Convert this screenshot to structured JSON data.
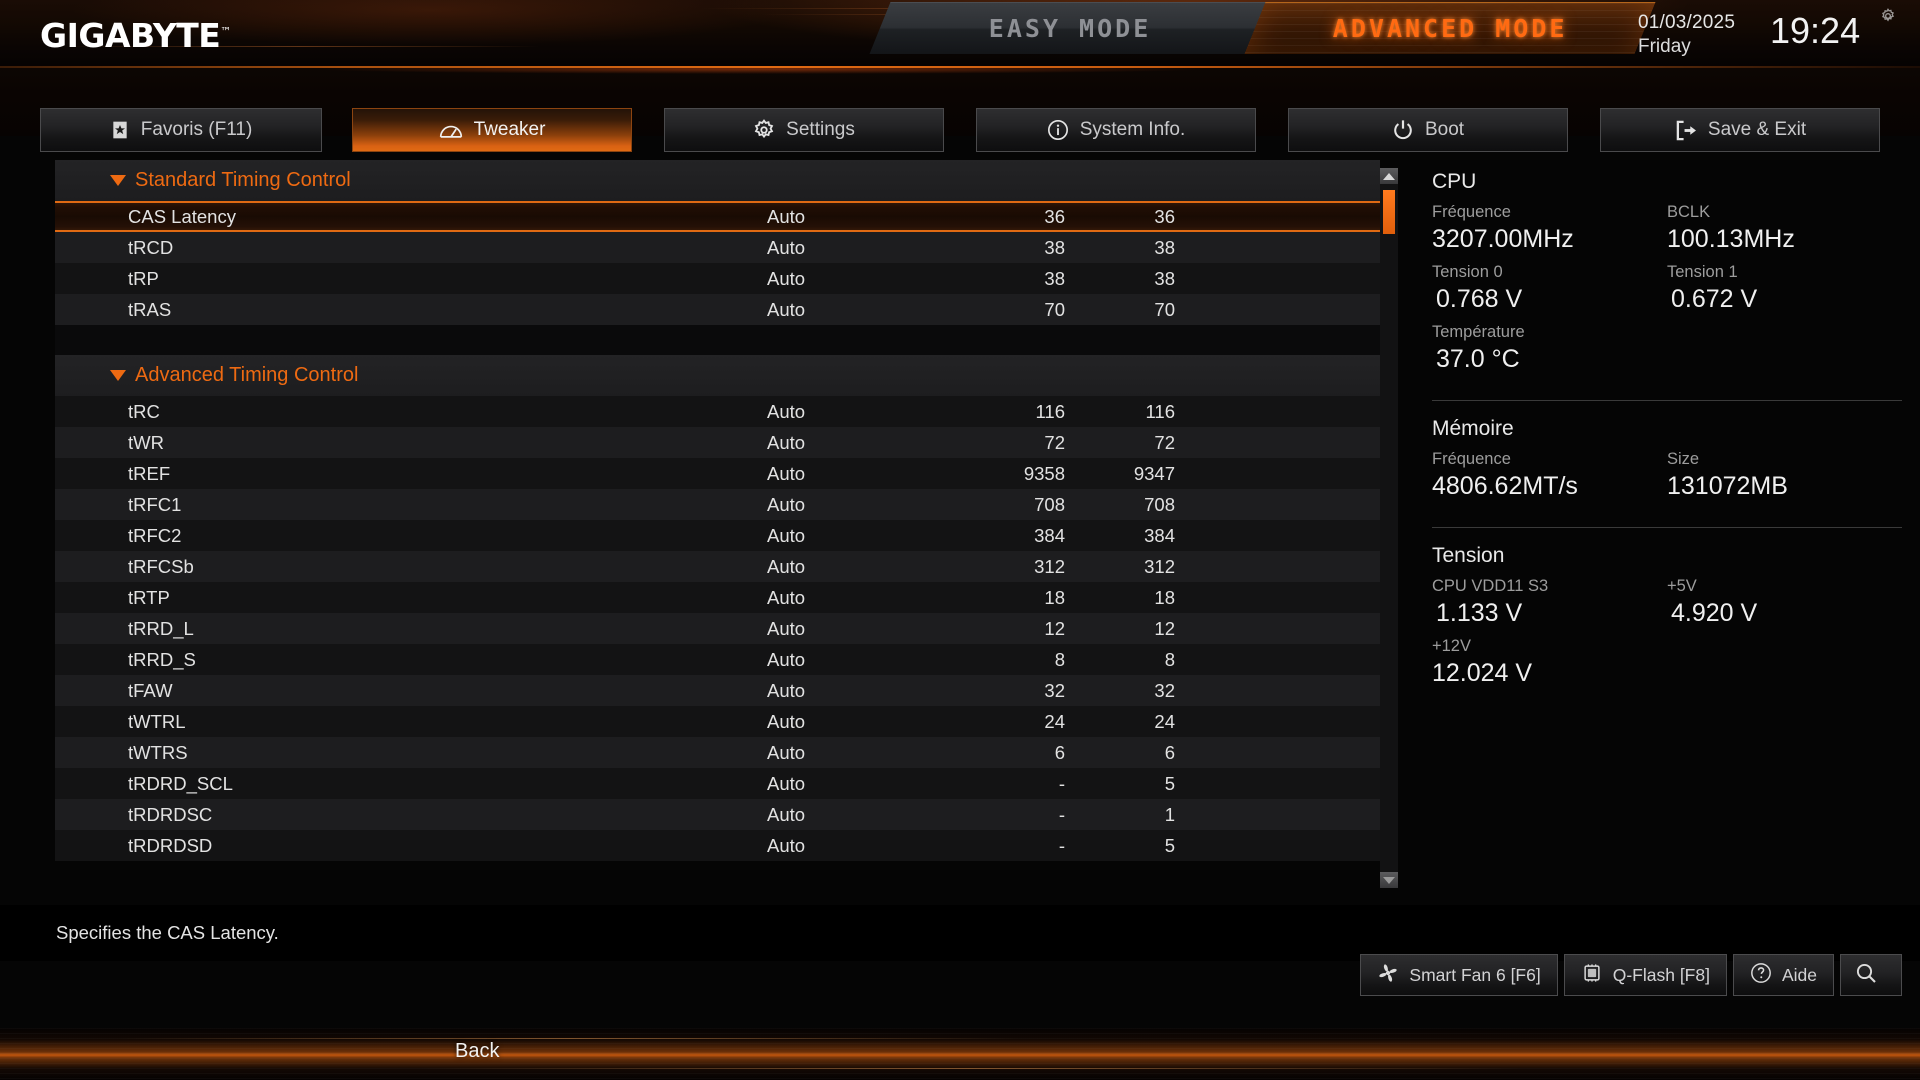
{
  "header": {
    "logo": "GIGABYTE",
    "logo_tm": "™",
    "mode_easy": "EASY MODE",
    "mode_advanced": "ADVANCED MODE",
    "date": "01/03/2025",
    "day": "Friday",
    "time": "19:24",
    "gear_icon": "gear-icon",
    "accent_color": "#e06a13"
  },
  "nav": {
    "tabs": [
      {
        "label": "Favoris (F11)",
        "icon": "favorite-star-icon",
        "active": false
      },
      {
        "label": "Tweaker",
        "icon": "gauge-icon",
        "active": true
      },
      {
        "label": "Settings",
        "icon": "gear-icon",
        "active": false
      },
      {
        "label": "System Info.",
        "icon": "info-circle-icon",
        "active": false
      },
      {
        "label": "Boot",
        "icon": "power-icon",
        "active": false
      },
      {
        "label": "Save & Exit",
        "icon": "exit-arrow-icon",
        "active": false
      }
    ]
  },
  "main": {
    "groups": [
      {
        "title": "Standard Timing Control",
        "collapse_icon": "triangle-down-icon",
        "rows": [
          {
            "name": "CAS Latency",
            "setting": "Auto",
            "v1": "36",
            "v2": "36",
            "selected": true
          },
          {
            "name": "tRCD",
            "setting": "Auto",
            "v1": "38",
            "v2": "38",
            "selected": false
          },
          {
            "name": "tRP",
            "setting": "Auto",
            "v1": "38",
            "v2": "38",
            "selected": false
          },
          {
            "name": "tRAS",
            "setting": "Auto",
            "v1": "70",
            "v2": "70",
            "selected": false
          }
        ]
      },
      {
        "title": "Advanced Timing Control",
        "collapse_icon": "triangle-down-icon",
        "rows": [
          {
            "name": "tRC",
            "setting": "Auto",
            "v1": "116",
            "v2": "116",
            "selected": false
          },
          {
            "name": "tWR",
            "setting": "Auto",
            "v1": "72",
            "v2": "72",
            "selected": false
          },
          {
            "name": "tREF",
            "setting": "Auto",
            "v1": "9358",
            "v2": "9347",
            "selected": false
          },
          {
            "name": "tRFC1",
            "setting": "Auto",
            "v1": "708",
            "v2": "708",
            "selected": false
          },
          {
            "name": "tRFC2",
            "setting": "Auto",
            "v1": "384",
            "v2": "384",
            "selected": false
          },
          {
            "name": "tRFCSb",
            "setting": "Auto",
            "v1": "312",
            "v2": "312",
            "selected": false
          },
          {
            "name": "tRTP",
            "setting": "Auto",
            "v1": "18",
            "v2": "18",
            "selected": false
          },
          {
            "name": "tRRD_L",
            "setting": "Auto",
            "v1": "12",
            "v2": "12",
            "selected": false
          },
          {
            "name": "tRRD_S",
            "setting": "Auto",
            "v1": "8",
            "v2": "8",
            "selected": false
          },
          {
            "name": "tFAW",
            "setting": "Auto",
            "v1": "32",
            "v2": "32",
            "selected": false
          },
          {
            "name": "tWTRL",
            "setting": "Auto",
            "v1": "24",
            "v2": "24",
            "selected": false
          },
          {
            "name": "tWTRS",
            "setting": "Auto",
            "v1": "6",
            "v2": "6",
            "selected": false
          },
          {
            "name": "tRDRD_SCL",
            "setting": "Auto",
            "v1": "-",
            "v2": "5",
            "selected": false
          },
          {
            "name": "tRDRDSC",
            "setting": "Auto",
            "v1": "-",
            "v2": "1",
            "selected": false
          },
          {
            "name": "tRDRDSD",
            "setting": "Auto",
            "v1": "-",
            "v2": "5",
            "selected": false
          }
        ]
      }
    ],
    "scrollbar": {
      "up_icon": "scroll-up-arrow-icon",
      "down_icon": "scroll-down-arrow-icon"
    }
  },
  "info_panel": {
    "cpu": {
      "title": "CPU",
      "items": [
        {
          "label": "Fréquence",
          "value": "3207.00MHz"
        },
        {
          "label": "BCLK",
          "value": "100.13MHz"
        },
        {
          "label": "Tension 0",
          "value": "0.768 V"
        },
        {
          "label": "Tension 1",
          "value": "0.672 V"
        },
        {
          "label": "Température",
          "value": "37.0 °C"
        }
      ]
    },
    "memory": {
      "title": "Mémoire",
      "items": [
        {
          "label": "Fréquence",
          "value": "4806.62MT/s"
        },
        {
          "label": "Size",
          "value": "131072MB"
        }
      ]
    },
    "voltage": {
      "title": "Tension",
      "items": [
        {
          "label": "CPU VDD11 S3",
          "value": "1.133 V"
        },
        {
          "label": "+5V",
          "value": "4.920 V"
        },
        {
          "label": "+12V",
          "value": "12.024 V"
        }
      ]
    }
  },
  "bottom": {
    "help_text": "Specifies the CAS Latency.",
    "buttons": [
      {
        "label": "Smart Fan 6 [F6]",
        "icon": "fan-icon"
      },
      {
        "label": "Q-Flash [F8]",
        "icon": "chip-icon"
      },
      {
        "label": "Aide",
        "icon": "help-circle-icon"
      },
      {
        "label": "",
        "icon": "search-icon"
      }
    ],
    "back_label": "Back"
  }
}
